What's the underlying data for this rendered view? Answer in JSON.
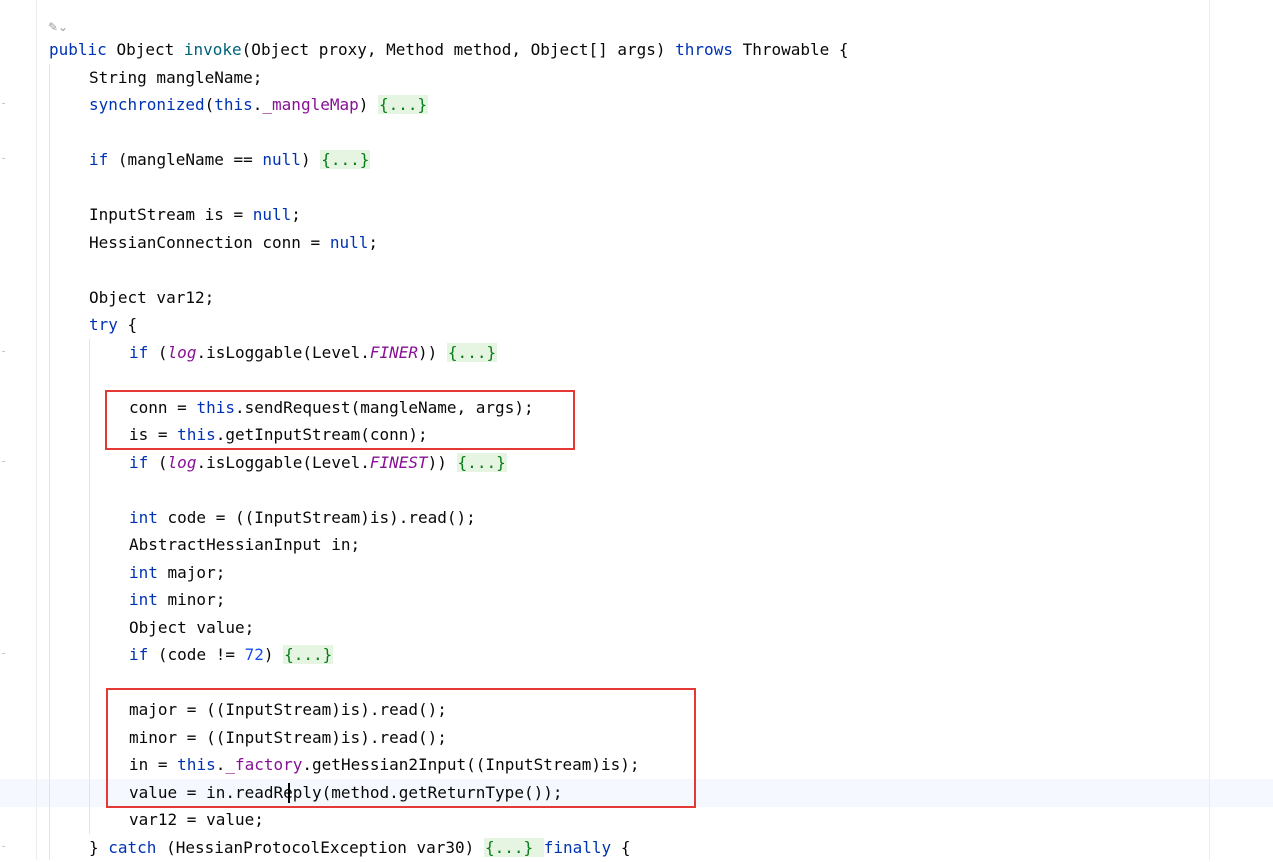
{
  "editor": {
    "language": "java",
    "inlay_hint": "✎⌄",
    "highlight_color": "#e53935",
    "lines": {
      "l1": [
        "public ",
        "Object ",
        "invoke",
        "(Object proxy, Method method, Object[] args) ",
        "throws ",
        "Throwable {"
      ],
      "l2": [
        "String mangleName;"
      ],
      "l3": [
        "synchronized",
        "(",
        "this",
        ".",
        "_mangleMap",
        ") ",
        "{...}"
      ],
      "l4": [
        "if ",
        "(mangleName == ",
        "null",
        ") ",
        "{...}"
      ],
      "l5": [
        "InputStream is = ",
        "null",
        ";"
      ],
      "l6": [
        "HessianConnection conn = ",
        "null",
        ";"
      ],
      "l7": [
        "Object var12;"
      ],
      "l8": [
        "try ",
        "{"
      ],
      "l9": [
        "if ",
        "(",
        "log",
        ".isLoggable(Level.",
        "FINER",
        ")) ",
        "{...}"
      ],
      "l10": [
        "conn = ",
        "this",
        ".sendRequest(mangleName, args);"
      ],
      "l11": [
        "is = ",
        "this",
        ".getInputStream(conn);"
      ],
      "l12": [
        "if ",
        "(",
        "log",
        ".isLoggable(Level.",
        "FINEST",
        ")) ",
        "{...}"
      ],
      "l13": [
        "int ",
        "code = ((InputStream)is).read();"
      ],
      "l14": [
        "AbstractHessianInput in;"
      ],
      "l15": [
        "int ",
        "major;"
      ],
      "l16": [
        "int ",
        "minor;"
      ],
      "l17": [
        "Object value;"
      ],
      "l18": [
        "if ",
        "(code != ",
        "72",
        ") ",
        "{...}"
      ],
      "l19": [
        "major = ((InputStream)is).read();"
      ],
      "l20": [
        "minor = ((InputStream)is).read();"
      ],
      "l21": [
        "in = ",
        "this",
        ".",
        "_factory",
        ".getHessian2Input((InputStream)is);"
      ],
      "l22": [
        "value = in.readR",
        "eply(method.getReturnType());"
      ],
      "l23": [
        "var12 = value;"
      ],
      "l24": [
        "} ",
        "catch ",
        "(HessianProtocolException var30) ",
        "{...} ",
        "finally ",
        "{"
      ]
    }
  }
}
